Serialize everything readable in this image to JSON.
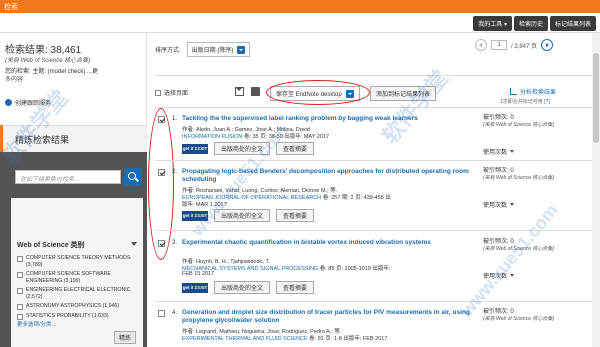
{
  "topbar": {
    "title": "检索"
  },
  "nav": {
    "tools": "我的工具 ▾",
    "history": "检索历史",
    "marked": "标记结果列表"
  },
  "left": {
    "results_label": "检索结果: 38,461",
    "results_sub": "(来自 Web of Science 核心合集)",
    "query_label": "您的检索: 主题: (model check) ...更",
    "query_more": "多内容",
    "alert": "创建跟踪服务",
    "refine_title": "精炼检索结果",
    "refine_placeholder": "在如下结果集内检索...",
    "category_title": "Web of Science 类别",
    "categories": [
      {
        "name": "COMPUTER SCIENCE THEORY METHODS (3,789)"
      },
      {
        "name": "COMPUTER SCIENCE SOFTWARE ENGINEERING (3,199)"
      },
      {
        "name": "ENGINEERING ELECTRICAL ELECTRONIC (2,572)"
      },
      {
        "name": "ASTRONOMY ASTROPHYSICS (1,946)"
      },
      {
        "name": "STATISTICS PROBABILITY (1,633)"
      }
    ],
    "more_options": "更多选项/分类...",
    "refine_button": "精炼"
  },
  "sort": {
    "label": "排序方式:",
    "value": "出版日期 (降序)"
  },
  "pager": {
    "page": "1",
    "of": "/ 3,847 页"
  },
  "toolbar": {
    "select_page": "选择页面",
    "save_to": "保存至 EndNote desktop",
    "add_marked": "添加到标记结果列表",
    "analyze": "分析检索结果",
    "cite_note": "1次即合并标记可用",
    "cite_help": "[?]"
  },
  "records": [
    {
      "num": "1.",
      "title": "Tackling the the supervised label ranking problem by bagging weak learners",
      "authors": "作者: Aledo, Juan A.; Gamez, Jose A.; Molina, David",
      "source": "INFORMATION FUSION",
      "meta": "卷: 35  页: 38-50  出版年: MAY 2017",
      "date": "",
      "getit": "get it ΣΞXIT",
      "fulltext": "出版商处的全文",
      "abstract": "查看摘要",
      "cited": "被引频次: 0",
      "cited_sub": "(来自 Web of Science 核心合集)",
      "usage": "使用次数"
    },
    {
      "num": "2.",
      "title": "Propagating logic-based Benders' decomposition approaches for distributed operating room scheduling",
      "authors": "作者: Roshanaei, Vahid; Luong, Curtiss; Aleman, Dionne M.; 等.",
      "source": "EUROPEAN JOURNAL OF OPERATIONAL RESEARCH",
      "meta": "卷: 257  期: 2  页: 439-455  出",
      "date": "版年: MAR 1 2017",
      "getit": "get it ΣΞXIT",
      "fulltext": "出版商处的全文",
      "abstract": "查看摘要",
      "cited": "被引频次: 0",
      "cited_sub": "(来自 Web of Science 核心合集)",
      "usage": "使用次数"
    },
    {
      "num": "3.",
      "title": "Experimental chaotic quantification in bistable vortex induced vibration systems",
      "authors": "作者: Huynh, B. H.; Tjahjowidodo, T.",
      "source": "MECHANICAL SYSTEMS AND SIGNAL PROCESSING",
      "meta": "卷: 85  页: 1005-1019  出版年:",
      "date": "FEB 15 2017",
      "getit": "get it ΣΞXIT",
      "fulltext": "出版商处的全文",
      "abstract": "查看摘要",
      "cited": "被引频次: 0",
      "cited_sub": "(来自 Web of Science 核心合集)",
      "usage": "使用次数"
    },
    {
      "num": "4.",
      "title": "Generation and droplet size distribution of tracer particles for PIV measurements in air, using propylene glycol/water solution",
      "authors": "作者: Legrand, Mathieu; Nogueira, Jose; Rodriguez, Pedro A.; 等.",
      "source": "EXPERIMENTAL THERMAL AND FLUID SCIENCE",
      "meta": "卷: 81  页: 1-8  出版年: FEB 2017",
      "date": "",
      "cited": "被引频次: 0",
      "cited_sub": "(来自 Web of Science 核心合集)"
    }
  ],
  "watermark": [
    "软件学堂",
    "www.xue51.com",
    "软件学堂",
    "www.xue51.com"
  ]
}
